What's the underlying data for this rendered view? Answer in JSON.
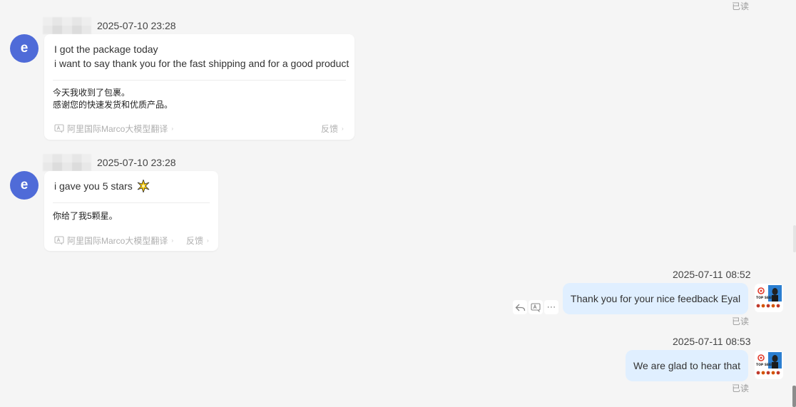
{
  "read_label": "已读",
  "incoming": [
    {
      "avatar_letter": "e",
      "timestamp": "2025-07-10 23:28",
      "lines": [
        "I got the package today",
        "i want to say thank you for the fast shipping and for a good product"
      ],
      "translation": [
        "今天我收到了包裹。",
        "感谢您的快速发货和优质产品。"
      ],
      "translator": "阿里国际Marco大模型翻译",
      "feedback": "反馈"
    },
    {
      "avatar_letter": "e",
      "timestamp": "2025-07-10 23:28",
      "lines": [
        "i gave you 5 stars"
      ],
      "translation": [
        "你给了我5颗星。"
      ],
      "translator": "阿里国际Marco大模型翻译",
      "feedback": "反馈"
    }
  ],
  "outgoing": [
    {
      "timestamp": "2025-07-11 08:52",
      "text": "Thank you for your nice feedback Eyal",
      "actions": [
        "reply-icon",
        "translate-icon",
        "more-icon"
      ],
      "more_glyph": "⋯"
    },
    {
      "timestamp": "2025-07-11 08:53",
      "text": "We are glad to hear that"
    }
  ],
  "colors": {
    "outgoing_bubble": "#e0efff",
    "avatar": "#4f6bd8",
    "background": "#f5f5f5"
  }
}
